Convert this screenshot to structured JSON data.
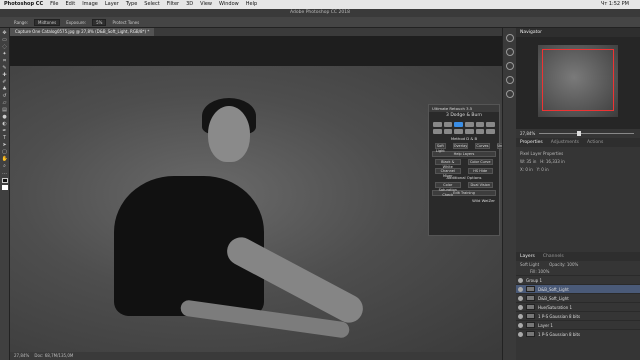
{
  "mac_menu": {
    "app": "Photoshop CC",
    "items": [
      "File",
      "Edit",
      "Image",
      "Layer",
      "Type",
      "Select",
      "Filter",
      "3D",
      "View",
      "Window",
      "Help"
    ],
    "clock": "Чт 1:52 PM"
  },
  "window_title": "Adobe Photoshop CC 2018",
  "options": {
    "range_label": "Range:",
    "range_value": "Midtones",
    "exposure_label": "Exposure:",
    "exposure_value": "5%",
    "protect_tones": "Protect Tones"
  },
  "document_tab": "Capture One Catalog0575.jpg @ 27,8% (D&B_Soft_Light, RGB/8*) *",
  "status": {
    "zoom": "27,84%",
    "doc": "Doc: 68,7M/135,0M"
  },
  "navigator": {
    "title": "Navigator",
    "zoom": "27,84%"
  },
  "properties": {
    "tabs": [
      "Properties",
      "Adjustments",
      "Actions"
    ],
    "title": "Pixel Layer Properties",
    "w_label": "W:",
    "w_value": "35 in",
    "h_label": "H:",
    "h_value": "16,333 in",
    "x_label": "X:",
    "x_value": "0 in",
    "y_label": "Y:",
    "y_value": "0 in"
  },
  "layers": {
    "tabs": [
      "Layers",
      "Channels"
    ],
    "blend": "Soft Light",
    "opacity_label": "Opacity:",
    "opacity": "100%",
    "fill_label": "Fill:",
    "fill": "100%",
    "items": [
      "Group 1",
      "D&B_Soft_Light",
      "D&B_Soft_Light",
      "Hue/Saturation 1",
      "1 P-S Gaussian 8 bits",
      "Layer 1",
      "1 P-S Gaussian 8 bits"
    ]
  },
  "retouch": {
    "title": "Ultimate Retouch 3.5",
    "section": "3 Dodge & Burn",
    "method": "Method D & B",
    "buttons_a": [
      "Soft Light",
      "Overlay",
      "Curves",
      "Undo"
    ],
    "help_layers": "Help Layers",
    "buttons_b": [
      "Black & White",
      "Color Curve",
      "Channel Mixer",
      "HS Hide"
    ],
    "additional": "Additional Options",
    "buttons_c": [
      "Color Saturation Check",
      "Dual Vision"
    ],
    "edit": "Edit Training",
    "footer": "Wild WeiZer"
  }
}
